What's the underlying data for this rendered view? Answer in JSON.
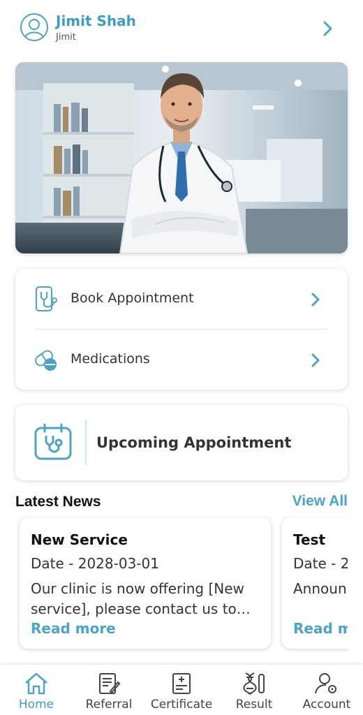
{
  "header": {
    "name": "Jimit Shah",
    "username": "Jimit"
  },
  "menu": {
    "items": [
      {
        "label": "Book Appointment",
        "icon": "stethoscope-phone-icon"
      },
      {
        "label": "Medications",
        "icon": "pills-icon"
      }
    ]
  },
  "upcoming": {
    "label": "Upcoming Appointment",
    "icon": "calendar-stethoscope-icon"
  },
  "news": {
    "title": "Latest News",
    "view_all": "View All",
    "items": [
      {
        "title": "New Service",
        "date": "Date - 2028-03-01",
        "body": "Our clinic is now offering [New service], please contact us to learn more.",
        "more": "Read more"
      },
      {
        "title": "Test",
        "date": "Date - 2",
        "body": "Announ",
        "more": "Read m"
      }
    ]
  },
  "nav": {
    "items": [
      {
        "label": "Home",
        "icon": "home-icon",
        "active": true
      },
      {
        "label": "Referral",
        "icon": "referral-icon"
      },
      {
        "label": "Certificate",
        "icon": "certificate-icon"
      },
      {
        "label": "Result",
        "icon": "dna-icon"
      },
      {
        "label": "Account",
        "icon": "account-settings-icon"
      }
    ]
  },
  "colors": {
    "accent": "#4aa3c8",
    "text": "#333333"
  }
}
